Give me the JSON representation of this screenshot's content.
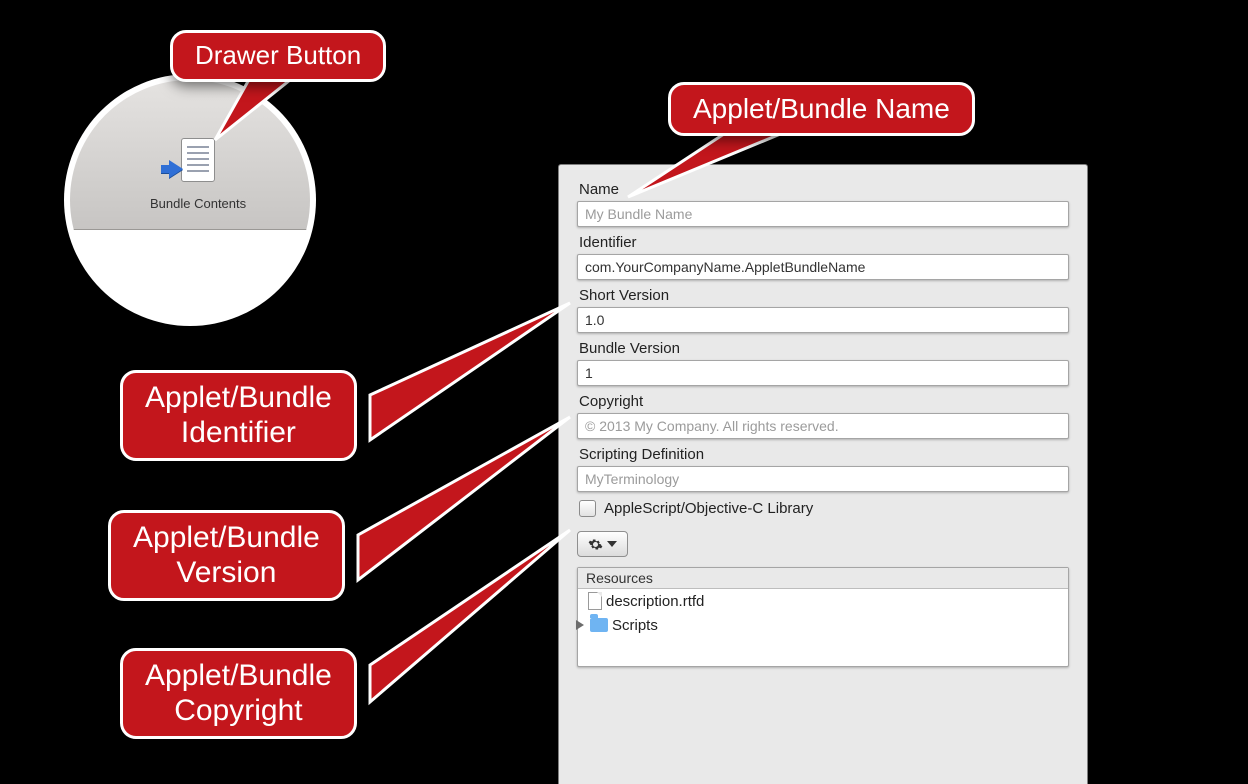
{
  "drawer_button": {
    "label": "Bundle Contents"
  },
  "callouts": {
    "drawer": "Drawer Button",
    "name": "Applet/Bundle Name",
    "identifier": "Applet/Bundle\nIdentifier",
    "version": "Applet/Bundle\nVersion",
    "copyright": "Applet/Bundle\nCopyright"
  },
  "panel": {
    "name_label": "Name",
    "name_placeholder": "My Bundle Name",
    "identifier_label": "Identifier",
    "identifier_value": "com.YourCompanyName.AppletBundleName",
    "short_version_label": "Short Version",
    "short_version_value": "1.0",
    "bundle_version_label": "Bundle Version",
    "bundle_version_value": "1",
    "copyright_label": "Copyright",
    "copyright_placeholder": "© 2013 My Company. All rights reserved.",
    "scripting_def_label": "Scripting Definition",
    "scripting_def_placeholder": "MyTerminology",
    "library_checkbox_label": "AppleScript/Objective-C Library",
    "resources_header": "Resources",
    "resources": {
      "file": "description.rtfd",
      "folder": "Scripts"
    }
  }
}
